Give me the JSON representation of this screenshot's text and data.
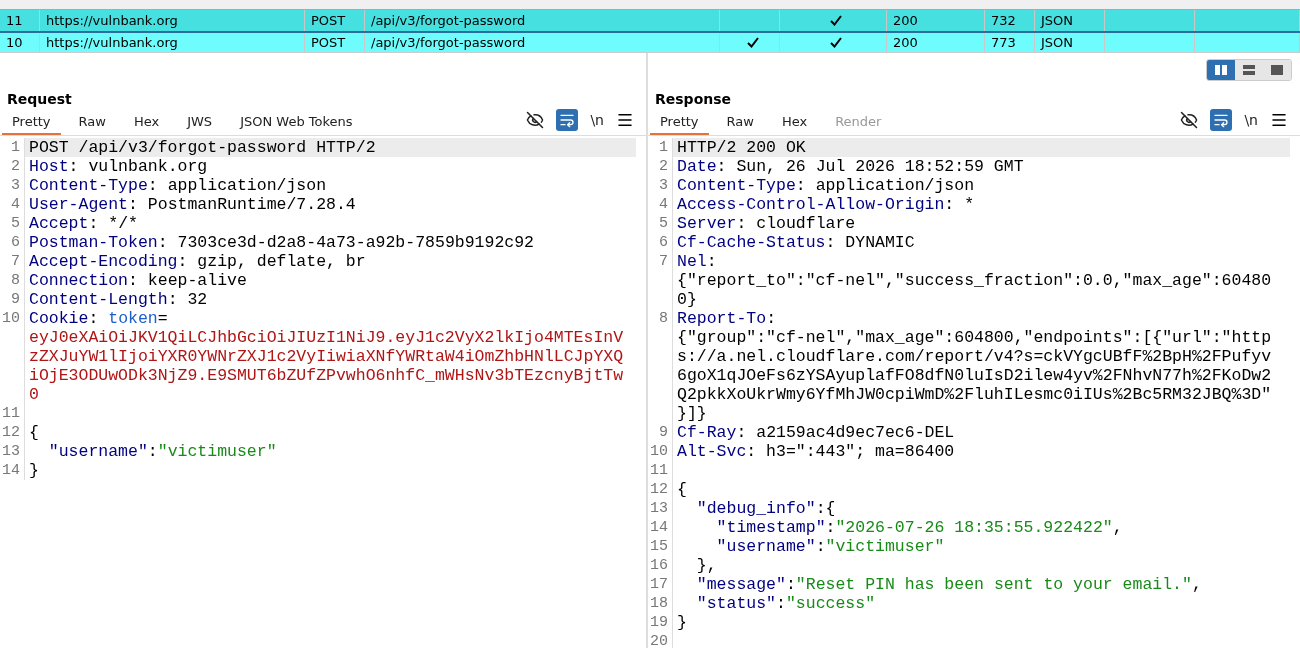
{
  "history": {
    "rows": [
      {
        "number": "11",
        "host": "https://vulnbank.org",
        "method": "POST",
        "url": "/api/v3/forgot-password",
        "edited": false,
        "params": true,
        "status": "200",
        "length": "732",
        "mime": "JSON",
        "selected": true,
        "color": "#46e0e0"
      },
      {
        "number": "10",
        "host": "https://vulnbank.org",
        "method": "POST",
        "url": "/api/v3/forgot-password",
        "edited": true,
        "params": true,
        "status": "200",
        "length": "773",
        "mime": "JSON",
        "selected": false,
        "color": "#6ffcfc"
      }
    ]
  },
  "layout_buttons": [
    {
      "kind": "columns",
      "selected": true
    },
    {
      "kind": "rows",
      "selected": false
    },
    {
      "kind": "single",
      "selected": false
    }
  ],
  "request": {
    "title": "Request",
    "tabs": [
      {
        "label": "Pretty",
        "selected": true,
        "disabled": false
      },
      {
        "label": "Raw",
        "selected": false,
        "disabled": false
      },
      {
        "label": "Hex",
        "selected": false,
        "disabled": false
      },
      {
        "label": "JWS",
        "selected": false,
        "disabled": false
      },
      {
        "label": "JSON Web Tokens",
        "selected": false,
        "disabled": false
      }
    ],
    "tools": {
      "hide_on": false,
      "wrap_on": true,
      "newline_label": "\\n"
    },
    "lines": [
      {
        "number": "1",
        "current": true,
        "rows": [
          [
            {
              "kind": "text",
              "text": "POST /api/v3/forgot-password HTTP/2"
            }
          ]
        ]
      },
      {
        "number": "2",
        "current": false,
        "rows": [
          [
            {
              "kind": "name",
              "text": "Host"
            },
            {
              "kind": "text",
              "text": ": vulnbank.org"
            }
          ]
        ]
      },
      {
        "number": "3",
        "current": false,
        "rows": [
          [
            {
              "kind": "name",
              "text": "Content-Type"
            },
            {
              "kind": "text",
              "text": ": application/json"
            }
          ]
        ]
      },
      {
        "number": "4",
        "current": false,
        "rows": [
          [
            {
              "kind": "name",
              "text": "User-Agent"
            },
            {
              "kind": "text",
              "text": ": PostmanRuntime/7.28.4"
            }
          ]
        ]
      },
      {
        "number": "5",
        "current": false,
        "rows": [
          [
            {
              "kind": "name",
              "text": "Accept"
            },
            {
              "kind": "text",
              "text": ": */*"
            }
          ]
        ]
      },
      {
        "number": "6",
        "current": false,
        "rows": [
          [
            {
              "kind": "name",
              "text": "Postman-Token"
            },
            {
              "kind": "text",
              "text": ": 7303ce3d-d2a8-4a73-a92b-7859b9192c92"
            }
          ]
        ]
      },
      {
        "number": "7",
        "current": false,
        "rows": [
          [
            {
              "kind": "name",
              "text": "Accept-Encoding"
            },
            {
              "kind": "text",
              "text": ": gzip, deflate, br"
            }
          ]
        ]
      },
      {
        "number": "8",
        "current": false,
        "rows": [
          [
            {
              "kind": "name",
              "text": "Connection"
            },
            {
              "kind": "text",
              "text": ": keep-alive"
            }
          ]
        ]
      },
      {
        "number": "9",
        "current": false,
        "rows": [
          [
            {
              "kind": "name",
              "text": "Content-Length"
            },
            {
              "kind": "text",
              "text": ": 32"
            }
          ]
        ]
      },
      {
        "number": "10",
        "current": false,
        "rows": [
          [
            {
              "kind": "name",
              "text": "Cookie"
            },
            {
              "kind": "text",
              "text": ": "
            },
            {
              "kind": "param",
              "text": "token"
            },
            {
              "kind": "text",
              "text": "="
            }
          ],
          [
            {
              "kind": "cookie",
              "text": "eyJ0eXAiOiJKV1QiLCJhbGciOiJIUzI1NiJ9.eyJ1c2VyX2lkIjo4MTEsInV"
            }
          ],
          [
            {
              "kind": "cookie",
              "text": "zZXJuYW1lIjoiYXR0YWNrZXJ1c2VyIiwiaXNfYWRtaW4iOmZhbHNlLCJpYXQ"
            }
          ],
          [
            {
              "kind": "cookie",
              "text": "iOjE3ODUwODk3NjZ9.E9SMUT6bZUfZPvwhO6nhfC_mWHsNv3bTEzcnyBjtTw"
            }
          ],
          [
            {
              "kind": "cookie",
              "text": "0"
            }
          ]
        ]
      },
      {
        "number": "11",
        "current": false,
        "rows": [
          []
        ]
      },
      {
        "number": "12",
        "current": false,
        "rows": [
          [
            {
              "kind": "text",
              "text": "{"
            }
          ]
        ]
      },
      {
        "number": "13",
        "current": false,
        "rows": [
          [
            {
              "kind": "indent",
              "text": "  "
            },
            {
              "kind": "key",
              "text": "\"username\""
            },
            {
              "kind": "text",
              "text": ":"
            },
            {
              "kind": "string",
              "text": "\"victimuser\""
            }
          ]
        ]
      },
      {
        "number": "14",
        "current": false,
        "rows": [
          [
            {
              "kind": "text",
              "text": "}"
            }
          ]
        ]
      }
    ]
  },
  "response": {
    "title": "Response",
    "tabs": [
      {
        "label": "Pretty",
        "selected": true,
        "disabled": false
      },
      {
        "label": "Raw",
        "selected": false,
        "disabled": false
      },
      {
        "label": "Hex",
        "selected": false,
        "disabled": false
      },
      {
        "label": "Render",
        "selected": false,
        "disabled": true
      }
    ],
    "tools": {
      "hide_on": false,
      "wrap_on": true,
      "newline_label": "\\n"
    },
    "lines": [
      {
        "number": "1",
        "current": true,
        "rows": [
          [
            {
              "kind": "text",
              "text": "HTTP/2 200 OK"
            }
          ]
        ]
      },
      {
        "number": "2",
        "current": false,
        "rows": [
          [
            {
              "kind": "name",
              "text": "Date"
            },
            {
              "kind": "text",
              "text": ": Sun, 26 Jul 2026 18:52:59 GMT"
            }
          ]
        ]
      },
      {
        "number": "3",
        "current": false,
        "rows": [
          [
            {
              "kind": "name",
              "text": "Content-Type"
            },
            {
              "kind": "text",
              "text": ": application/json"
            }
          ]
        ]
      },
      {
        "number": "4",
        "current": false,
        "rows": [
          [
            {
              "kind": "name",
              "text": "Access-Control-Allow-Origin"
            },
            {
              "kind": "text",
              "text": ": *"
            }
          ]
        ]
      },
      {
        "number": "5",
        "current": false,
        "rows": [
          [
            {
              "kind": "name",
              "text": "Server"
            },
            {
              "kind": "text",
              "text": ": cloudflare"
            }
          ]
        ]
      },
      {
        "number": "6",
        "current": false,
        "rows": [
          [
            {
              "kind": "name",
              "text": "Cf-Cache-Status"
            },
            {
              "kind": "text",
              "text": ": DYNAMIC"
            }
          ]
        ]
      },
      {
        "number": "7",
        "current": false,
        "rows": [
          [
            {
              "kind": "name",
              "text": "Nel"
            },
            {
              "kind": "text",
              "text": ":"
            }
          ],
          [
            {
              "kind": "text",
              "text": "{\"report_to\":\"cf-nel\",\"success_fraction\":0.0,\"max_age\":60480"
            }
          ],
          [
            {
              "kind": "text",
              "text": "0}"
            }
          ]
        ]
      },
      {
        "number": "8",
        "current": false,
        "rows": [
          [
            {
              "kind": "name",
              "text": "Report-To"
            },
            {
              "kind": "text",
              "text": ":"
            }
          ],
          [
            {
              "kind": "text",
              "text": "{\"group\":\"cf-nel\",\"max_age\":604800,\"endpoints\":[{\"url\":\"http"
            }
          ],
          [
            {
              "kind": "text",
              "text": "s://a.nel.cloudflare.com/report/v4?s=ckVYgcUBfF%2BpH%2FPufyv"
            }
          ],
          [
            {
              "kind": "text",
              "text": "6goX1qJOeFs6zYSAyuplafFO8dfN0luIsD2ilew4yv%2FNhvN77h%2FKoDw2"
            }
          ],
          [
            {
              "kind": "text",
              "text": "Q2pkkXoUkrWmy6YfMhJW0cpiWmD%2FluhILesmc0iIUs%2Bc5RM32JBQ%3D\""
            }
          ],
          [
            {
              "kind": "text",
              "text": "}]}"
            }
          ]
        ]
      },
      {
        "number": "9",
        "current": false,
        "rows": [
          [
            {
              "kind": "name",
              "text": "Cf-Ray"
            },
            {
              "kind": "text",
              "text": ": a2159ac4d9ec7ec6-DEL"
            }
          ]
        ]
      },
      {
        "number": "10",
        "current": false,
        "rows": [
          [
            {
              "kind": "name",
              "text": "Alt-Svc"
            },
            {
              "kind": "text",
              "text": ": h3=\":443\"; ma=86400"
            }
          ]
        ]
      },
      {
        "number": "11",
        "current": false,
        "rows": [
          []
        ]
      },
      {
        "number": "12",
        "current": false,
        "rows": [
          [
            {
              "kind": "text",
              "text": "{"
            }
          ]
        ]
      },
      {
        "number": "13",
        "current": false,
        "rows": [
          [
            {
              "kind": "indent",
              "text": "  "
            },
            {
              "kind": "key",
              "text": "\"debug_info\""
            },
            {
              "kind": "text",
              "text": ":{"
            }
          ]
        ]
      },
      {
        "number": "14",
        "current": false,
        "rows": [
          [
            {
              "kind": "indent",
              "text": "    "
            },
            {
              "kind": "key",
              "text": "\"timestamp\""
            },
            {
              "kind": "text",
              "text": ":"
            },
            {
              "kind": "string",
              "text": "\"2026-07-26 18:35:55.922422\""
            },
            {
              "kind": "text",
              "text": ","
            }
          ]
        ]
      },
      {
        "number": "15",
        "current": false,
        "rows": [
          [
            {
              "kind": "indent",
              "text": "    "
            },
            {
              "kind": "key",
              "text": "\"username\""
            },
            {
              "kind": "text",
              "text": ":"
            },
            {
              "kind": "string",
              "text": "\"victimuser\""
            }
          ]
        ]
      },
      {
        "number": "16",
        "current": false,
        "rows": [
          [
            {
              "kind": "indent",
              "text": "  "
            },
            {
              "kind": "text",
              "text": "},"
            }
          ]
        ]
      },
      {
        "number": "17",
        "current": false,
        "rows": [
          [
            {
              "kind": "indent",
              "text": "  "
            },
            {
              "kind": "key",
              "text": "\"message\""
            },
            {
              "kind": "text",
              "text": ":"
            },
            {
              "kind": "string",
              "text": "\"Reset PIN has been sent to your email.\""
            },
            {
              "kind": "text",
              "text": ","
            }
          ]
        ]
      },
      {
        "number": "18",
        "current": false,
        "rows": [
          [
            {
              "kind": "indent",
              "text": "  "
            },
            {
              "kind": "key",
              "text": "\"status\""
            },
            {
              "kind": "text",
              "text": ":"
            },
            {
              "kind": "string",
              "text": "\"success\""
            }
          ]
        ]
      },
      {
        "number": "19",
        "current": false,
        "rows": [
          [
            {
              "kind": "text",
              "text": "}"
            }
          ]
        ]
      },
      {
        "number": "20",
        "current": false,
        "rows": [
          []
        ]
      }
    ]
  }
}
